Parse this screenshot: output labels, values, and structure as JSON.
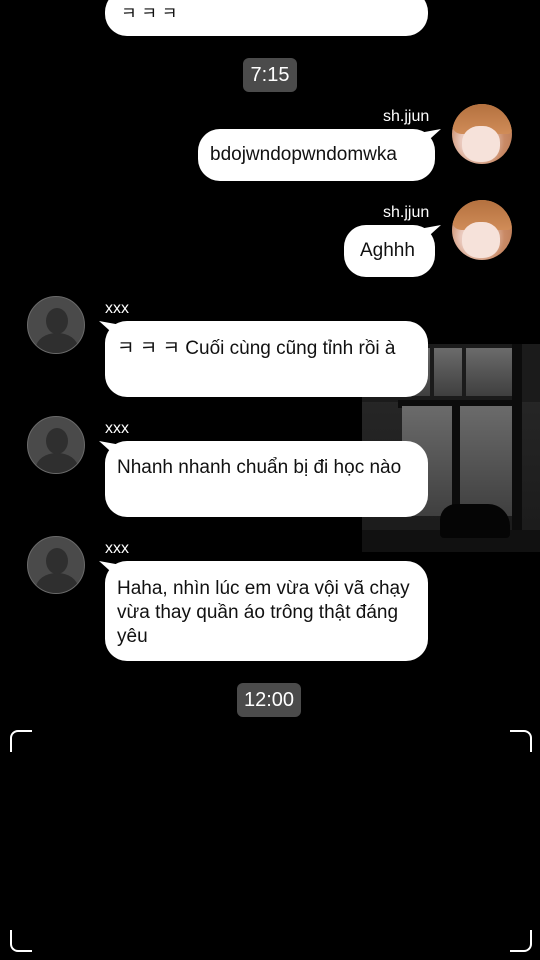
{
  "chat": {
    "top_partial_message": "ㅋ ㅋ ㅋ",
    "time_1": "7:15",
    "time_2": "12:00",
    "self_name": "sh.jjun",
    "other_name": "xxx",
    "messages": [
      {
        "sender": "sh.jjun",
        "text": "bdojwndopwndomwka"
      },
      {
        "sender": "sh.jjun",
        "text": "Aghhh"
      },
      {
        "sender": "xxx",
        "text": " ㅋ ㅋ ㅋ  Cuối cùng cũng tỉnh rồi à"
      },
      {
        "sender": "xxx",
        "text": " Nhanh nhanh chuẩn bị đi học nào"
      },
      {
        "sender": "xxx",
        "text": " Haha, nhìn lúc em vừa vội vã chạy vừa thay quần áo trông thật đáng yêu"
      }
    ]
  }
}
